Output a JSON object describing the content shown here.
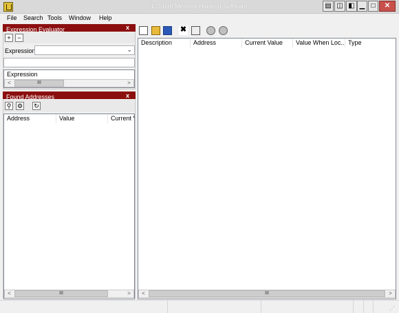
{
  "window": {
    "title": "L. Spiro  Memory Hacking Software",
    "minimize_glyph": "▁",
    "maximize_glyph": "□",
    "close_glyph": "✕"
  },
  "menu": {
    "items": [
      {
        "label": "File"
      },
      {
        "label": "Search"
      },
      {
        "label": "Tools"
      },
      {
        "label": "Window"
      },
      {
        "label": "Help"
      }
    ]
  },
  "expression_evaluator": {
    "title": "Expression Evaluator",
    "close_label": "x",
    "add_label": "+",
    "remove_label": "−",
    "expression_label": "Expression:",
    "expression_value": "",
    "result_value": "",
    "list_header": "Expression",
    "scroll_thumb": "III",
    "scroll_left": "<",
    "scroll_right": ">"
  },
  "found_addresses": {
    "title": "Found Addresses",
    "close_label": "x",
    "columns": [
      "Address",
      "Value",
      "Current V"
    ],
    "scroll_thumb": "III",
    "scroll_left": "<",
    "scroll_right": ">"
  },
  "main_list": {
    "columns": [
      "Description",
      "Address",
      "Current Value",
      "Value When Loc...",
      "Type"
    ],
    "scroll_thumb": "III",
    "scroll_left": "<",
    "scroll_right": ">"
  },
  "icons": {
    "app": "app-icon",
    "new": "new-document-icon",
    "open": "open-folder-icon",
    "save": "save-disk-icon",
    "delete": "delete-icon",
    "properties": "properties-icon",
    "lock": "gear-icon",
    "unlock": "gear-arrow-icon",
    "search": "search-icon",
    "search_options": "search-options-icon",
    "refresh": "refresh-icon"
  }
}
